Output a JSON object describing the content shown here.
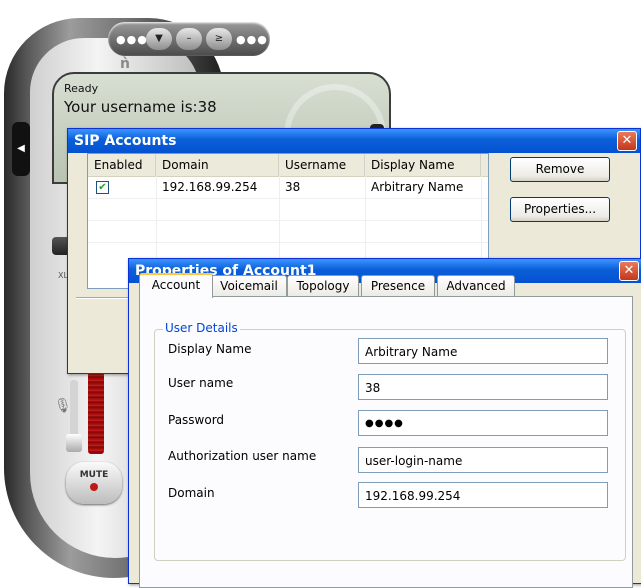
{
  "phone": {
    "status": "Ready",
    "message": "Your username is:38",
    "mute_label": "MUTE",
    "small_label": "XL"
  },
  "sip_accounts": {
    "title": "SIP Accounts",
    "columns": [
      "Enabled",
      "Domain",
      "Username",
      "Display Name"
    ],
    "rows": [
      {
        "enabled": true,
        "domain": "192.168.99.254",
        "username": "38",
        "display_name": "Arbitrary Name"
      }
    ],
    "buttons": {
      "remove": "Remove",
      "properties": "Properties..."
    }
  },
  "properties": {
    "title": "Properties of Account1",
    "tabs": [
      "Account",
      "Voicemail",
      "Topology",
      "Presence",
      "Advanced"
    ],
    "active_tab": "Account",
    "group_title": "User Details",
    "fields": [
      {
        "label": "Display Name",
        "value": "Arbitrary Name"
      },
      {
        "label": "User name",
        "value": "38"
      },
      {
        "label": "Password",
        "value": "●●●●"
      },
      {
        "label": "Authorization user name",
        "value": "user-login-name"
      },
      {
        "label": "Domain",
        "value": "192.168.99.254"
      }
    ]
  },
  "colors": {
    "titlebar": "#0a5fd8",
    "window_bg": "#ece9d8",
    "group_title": "#0046d5",
    "check": "#21a121"
  }
}
